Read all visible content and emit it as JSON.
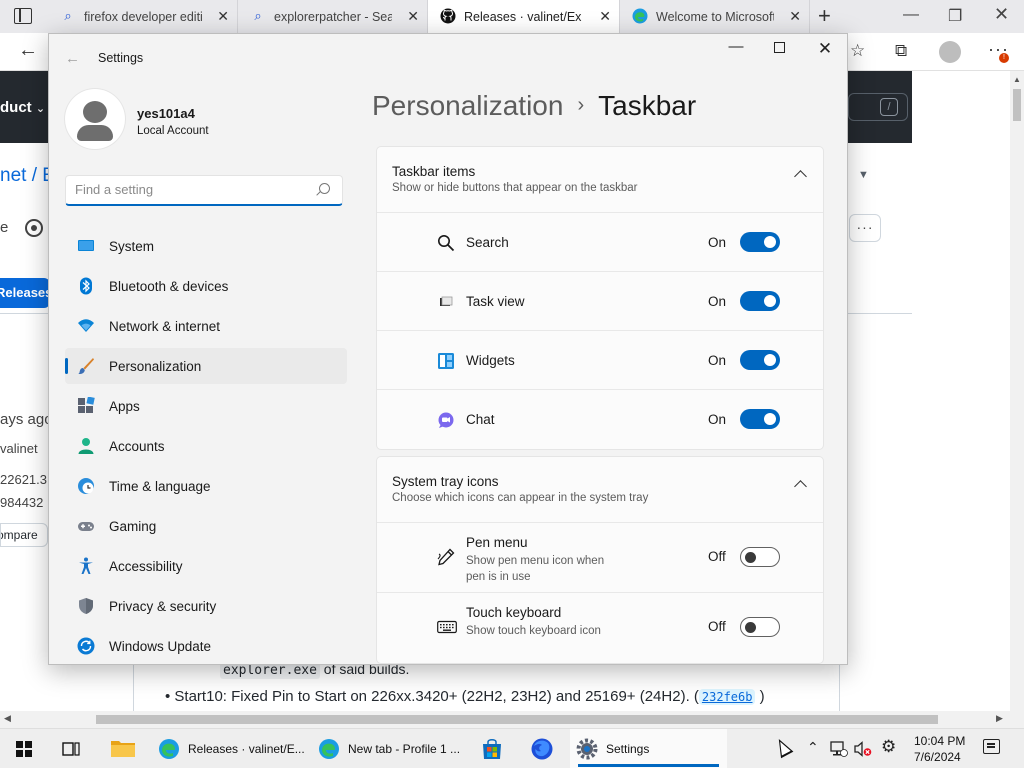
{
  "browser": {
    "tabs": [
      {
        "label": "firefox developer editio",
        "icon": "search-icon"
      },
      {
        "label": "explorerpatcher - Searc",
        "icon": "search-icon"
      },
      {
        "label": "Releases · valinet/Explo",
        "icon": "github-icon"
      },
      {
        "label": "Welcome to Microsoft E",
        "icon": "edge-icon"
      }
    ],
    "page": {
      "product_menu": "duct",
      "repo_path": "net / E",
      "releases_button": "Releases",
      "sidebar_lines": [
        "ays ago",
        "valinet",
        "22621.3",
        "984432"
      ],
      "compare_button": "ompare",
      "code_line_code": "explorer.exe",
      "code_line_text": " of said builds.",
      "bullet_text": "Start10: Fixed Pin to Start on 226xx.3420+ (22H2, 23H2) and 25169+ (24H2). (",
      "bullet_commit": "232fe6b",
      "bullet_end": " )"
    }
  },
  "settings": {
    "window_title": "Settings",
    "profile": {
      "name": "yes101a4",
      "account_type": "Local Account"
    },
    "search_placeholder": "Find a setting",
    "nav": [
      {
        "label": "System",
        "icon": "system-icon",
        "selected": false
      },
      {
        "label": "Bluetooth & devices",
        "icon": "bluetooth-icon",
        "selected": false
      },
      {
        "label": "Network & internet",
        "icon": "network-icon",
        "selected": false
      },
      {
        "label": "Personalization",
        "icon": "brush-icon",
        "selected": true
      },
      {
        "label": "Apps",
        "icon": "apps-icon",
        "selected": false
      },
      {
        "label": "Accounts",
        "icon": "accounts-icon",
        "selected": false
      },
      {
        "label": "Time & language",
        "icon": "time-language-icon",
        "selected": false
      },
      {
        "label": "Gaming",
        "icon": "gaming-icon",
        "selected": false
      },
      {
        "label": "Accessibility",
        "icon": "accessibility-icon",
        "selected": false
      },
      {
        "label": "Privacy & security",
        "icon": "shield-icon",
        "selected": false
      },
      {
        "label": "Windows Update",
        "icon": "update-icon",
        "selected": false
      }
    ],
    "breadcrumb": {
      "parent": "Personalization",
      "separator": "›",
      "current": "Taskbar"
    },
    "taskbar_items": {
      "title": "Taskbar items",
      "subtitle": "Show or hide buttons that appear on the taskbar",
      "items": [
        {
          "label": "Search",
          "state": "On",
          "icon": "search-icon"
        },
        {
          "label": "Task view",
          "state": "On",
          "icon": "task-view-icon"
        },
        {
          "label": "Widgets",
          "state": "On",
          "icon": "widgets-icon"
        },
        {
          "label": "Chat",
          "state": "On",
          "icon": "chat-icon"
        }
      ]
    },
    "system_tray": {
      "title": "System tray icons",
      "subtitle": "Choose which icons can appear in the system tray",
      "items": [
        {
          "label": "Pen menu",
          "desc": "Show pen menu icon when pen is in use",
          "state": "Off",
          "icon": "pen-icon"
        },
        {
          "label": "Touch keyboard",
          "desc": "Show touch keyboard icon",
          "state": "Off",
          "icon": "keyboard-icon"
        }
      ]
    }
  },
  "taskbar": {
    "apps": [
      {
        "label": "Releases · valinet/E...",
        "icon": "edge-icon"
      },
      {
        "label": "New tab - Profile 1 ...",
        "icon": "edge-icon"
      },
      {
        "label": "Settings",
        "icon": "gear-icon"
      }
    ],
    "time": "10:04 PM",
    "date": "7/6/2024"
  },
  "colors": {
    "accent": "#0067c0",
    "selected_bg": "#eaeaea"
  }
}
